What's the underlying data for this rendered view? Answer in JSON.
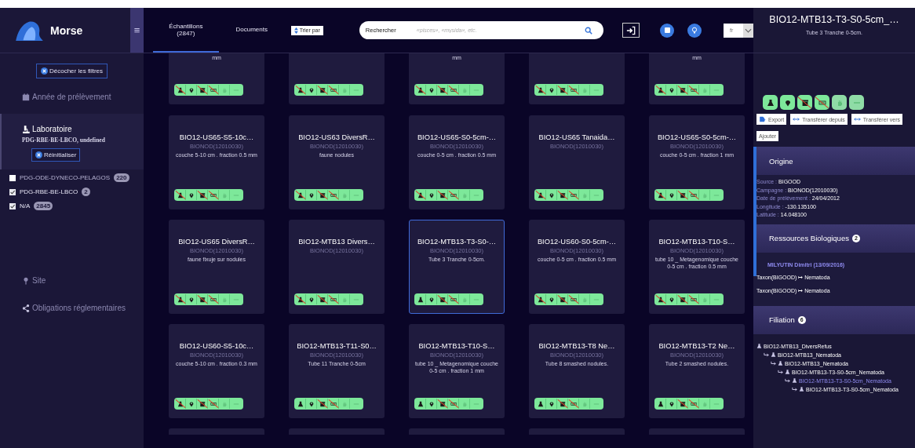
{
  "sidebar": {
    "app_name": "Morse",
    "menu_glyph": "≡",
    "clear_filters": "Décocher les filtres",
    "filters": [
      {
        "kind": "calendar",
        "label": "Année de prélèvement",
        "expanded": false
      },
      {
        "kind": "lab",
        "label": "Laboratoire",
        "expanded": true,
        "summary": "PDG-RBE-BE-LBCO, undefined",
        "reset": "Réinitialiser",
        "options": [
          {
            "label": "PDG-ODE-DYNECO-PELAGOS",
            "count": "220",
            "checked": false
          },
          {
            "label": "PDG-RBE-BE-LBCO",
            "count": "2",
            "checked": true
          },
          {
            "label": "N/A",
            "count": "2845",
            "checked": true
          }
        ]
      },
      {
        "kind": "pin",
        "label": "Site",
        "expanded": false
      },
      {
        "kind": "share",
        "label": "Obligations réglementaires",
        "expanded": false
      }
    ]
  },
  "tabs": [
    {
      "label": "Échantillons",
      "count": "(2847)",
      "selected": true
    },
    {
      "label": "Documents",
      "selected": false
    }
  ],
  "sort_button": "Trier par",
  "search": {
    "label": "Rechercher",
    "placeholder": "«pisces», «mysida», etc."
  },
  "language": "fr",
  "cards": [
    {
      "kind": "cut-top",
      "selected": false,
      "desc": "mm",
      "flask_crossed": true
    },
    {
      "kind": "cut-top",
      "selected": false,
      "flask_crossed": true
    },
    {
      "kind": "cut-top",
      "selected": false,
      "desc": "mm",
      "flask_crossed": true
    },
    {
      "kind": "cut-top",
      "selected": false,
      "flask_crossed": true
    },
    {
      "kind": "cut-top",
      "selected": false,
      "desc": "mm",
      "flask_crossed": true
    },
    {
      "kind": "full",
      "selected": false,
      "title": "BIO12-US65-S5-10c…",
      "campaign": "BIONOD(12010030)",
      "desc": "couche 5-10 cm . fraction 0.5 mm",
      "flask_crossed": true
    },
    {
      "kind": "full",
      "selected": false,
      "title": "BIO12-US63 DiversR…",
      "campaign": "BIONOD(12010030)",
      "desc": "faune nodules",
      "flask_crossed": true
    },
    {
      "kind": "full",
      "selected": false,
      "title": "BIO12-US65-S0-5cm-…",
      "campaign": "BIONOD(12010030)",
      "desc": "couche 0-5 cm . fraction 0.5 mm",
      "flask_crossed": true
    },
    {
      "kind": "full",
      "selected": false,
      "title": "BIO12-US65 Tanaida…",
      "campaign": "BIONOD(12010030)",
      "flask_crossed": true
    },
    {
      "kind": "full",
      "selected": false,
      "title": "BIO12-US65-S0-5cm-…",
      "campaign": "BIONOD(12010030)",
      "desc": "couche 0-5 cm . fraction 1 mm",
      "flask_crossed": true
    },
    {
      "kind": "full",
      "selected": false,
      "title": "BIO12-US65 DiversR…",
      "campaign": "BIONOD(12010030)",
      "desc": "faune fixuje sur nodules",
      "flask_crossed": true
    },
    {
      "kind": "full",
      "selected": false,
      "title": "BIO12-MTB13 Divers…",
      "campaign": "BIONOD(12010030)",
      "flask_crossed": true
    },
    {
      "kind": "full",
      "selected": true,
      "title": "BIO12-MTB13-T3-S0-…",
      "campaign": "BIONOD(12010030)",
      "desc": "Tube 3 Tranche 0-5cm.",
      "flask_crossed": false
    },
    {
      "kind": "full",
      "selected": false,
      "title": "BIO12-US60-S0-5cm-…",
      "campaign": "BIONOD(12010030)",
      "desc": "couche 0-5 cm . fraction 0.5 mm",
      "flask_crossed": true
    },
    {
      "kind": "full",
      "selected": false,
      "title": "BIO12-MTB13-T10-S…",
      "campaign": "BIONOD(12010030)",
      "desc": "tube 10 _ Metagenomique couche 0-5 cm . fraction 0.5 mm",
      "flask_crossed": true
    },
    {
      "kind": "full",
      "selected": false,
      "title": "BIO12-US60-S5-10c…",
      "campaign": "BIONOD(12010030)",
      "desc": "couche 5-10 cm . fraction 0.3 mm",
      "flask_crossed": true
    },
    {
      "kind": "full",
      "selected": false,
      "title": "BIO12-MTB13-T11-S0…",
      "campaign": "BIONOD(12010030)",
      "desc": "Tube 11 Tranche 0-5cm",
      "flask_crossed": false
    },
    {
      "kind": "full",
      "selected": false,
      "title": "BIO12-MTB13-T10-S…",
      "campaign": "BIONOD(12010030)",
      "desc": "tube 10 _ Metagenomique couche 0-5 cm . fraction 1 mm",
      "flask_crossed": false
    },
    {
      "kind": "full",
      "selected": false,
      "title": "BIO12-MTB13-T8 Ne…",
      "campaign": "BIONOD(12010030)",
      "desc": "Tube 8 smashed nodules.",
      "flask_crossed": false
    },
    {
      "kind": "full",
      "selected": false,
      "title": "BIO12-MTB13-T2 Ne…",
      "campaign": "BIONOD(12010030)",
      "desc": "Tube 2 smashed nodules.",
      "flask_crossed": false
    },
    {
      "kind": "cut-bottom",
      "selected": false
    },
    {
      "kind": "cut-bottom",
      "selected": false
    },
    {
      "kind": "cut-bottom",
      "selected": false
    },
    {
      "kind": "cut-bottom",
      "selected": false
    },
    {
      "kind": "cut-bottom",
      "selected": false
    }
  ],
  "detail": {
    "title": "BIO12-MTB13-T3-S0-5cm_…",
    "subtitle": "Tube 3 Tranche 0-5cm.",
    "chips": [
      {
        "kind": "flask",
        "crossed": false,
        "enabled": true
      },
      {
        "kind": "pin",
        "crossed": false,
        "enabled": true
      },
      {
        "kind": "box",
        "crossed": true,
        "enabled": true
      },
      {
        "kind": "doi",
        "crossed": true,
        "enabled": true
      },
      {
        "kind": "hand",
        "crossed": false,
        "enabled": false
      },
      {
        "kind": "tag",
        "crossed": false,
        "enabled": false
      }
    ],
    "actions": [
      {
        "kind": "export",
        "label": "Export"
      },
      {
        "kind": "transfer",
        "label": "Transférer depuis"
      },
      {
        "kind": "transfer",
        "label": "Transférer vers"
      },
      {
        "kind": "plain",
        "label": "Ajouter"
      }
    ],
    "origin": {
      "title": "Origine",
      "fields": [
        {
          "label": "Source :",
          "value": "BIGOOD"
        },
        {
          "label": "Campagne :",
          "value": "BIONOD(12010030)"
        },
        {
          "label": "Date de prélèvement :",
          "value": "24/04/2012"
        },
        {
          "label": "Longitude :",
          "value": "-130.135100"
        },
        {
          "label": "Latitude :",
          "value": "14.048100"
        }
      ]
    },
    "resources": {
      "title": "Ressources Biologiques",
      "count": "2",
      "author": "MILYUTIN Dimitri (13/09/2016)",
      "items": [
        {
          "taxon": "Taxon(BIGOOD)",
          "arrow": "↦",
          "value": "Nematoda"
        },
        {
          "taxon": "Taxon(BIGOOD)",
          "arrow": "↦",
          "value": "Nematoda"
        }
      ]
    },
    "filiation": {
      "title": "Filiation",
      "count": "6",
      "tree": [
        {
          "label": "BIO12-MTB13_DiversRefus",
          "selected": false,
          "children": [
            {
              "label": "BIO12-MTB13_Nematoda",
              "selected": false,
              "children": [
                {
                  "label": "BIO12-MTB13_Nematoda",
                  "selected": false,
                  "children": [
                    {
                      "label": "BIO12-MTB13-T3-S0-5cm_Nematoda",
                      "selected": false,
                      "children": [
                        {
                          "label": "BIO12-MTB13-T3-S0-5cm_Nematoda",
                          "selected": true,
                          "children": [
                            {
                              "label": "BIO12-MTB13-T3-S0-5cm_Nematoda",
                              "selected": false
                            }
                          ]
                        }
                      ]
                    }
                  ]
                }
              ]
            }
          ]
        }
      ]
    }
  }
}
